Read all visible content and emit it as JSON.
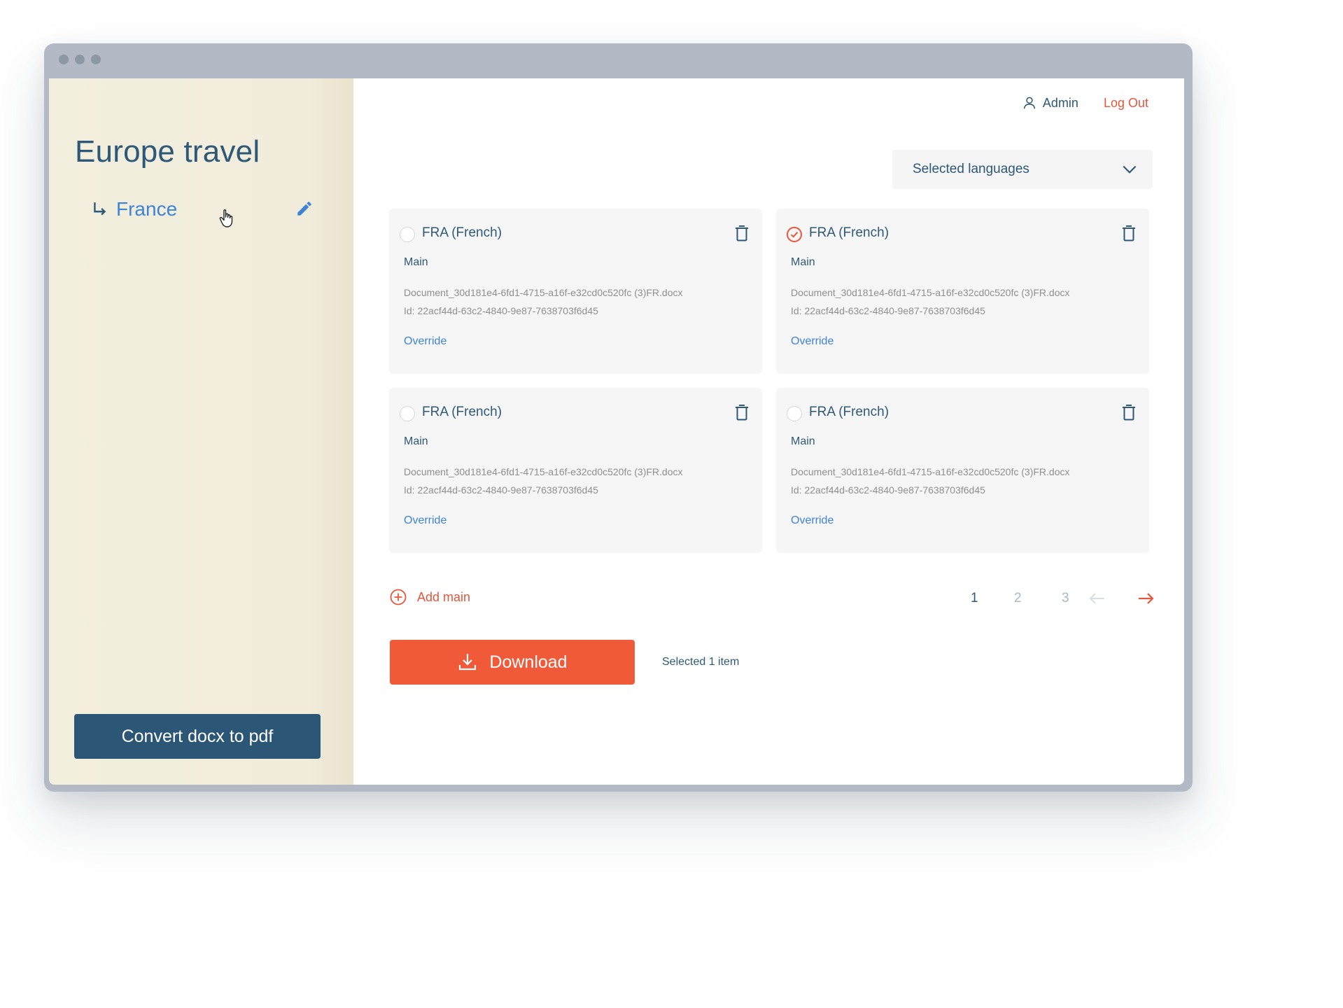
{
  "sidebar": {
    "project_title": "Europe travel",
    "sub_item_label": "France",
    "convert_button_label": "Convert docx to pdf"
  },
  "header": {
    "user_name": "Admin",
    "logout_label": "Log Out"
  },
  "language_select": {
    "selected_label": "Selected languages"
  },
  "cards": [
    {
      "title": "FRA (French)",
      "type": "Main",
      "file": "Document_30d181e4-6fd1-4715-a16f-e32cd0c520fc (3)FR.docx",
      "id": "Id: 22acf44d-63c2-4840-9e87-7638703f6d45",
      "override_label": "Override",
      "selected": false
    },
    {
      "title": "FRA (French)",
      "type": "Main",
      "file": "Document_30d181e4-6fd1-4715-a16f-e32cd0c520fc (3)FR.docx",
      "id": "Id: 22acf44d-63c2-4840-9e87-7638703f6d45",
      "override_label": "Override",
      "selected": true
    },
    {
      "title": "FRA (French)",
      "type": "Main",
      "file": "Document_30d181e4-6fd1-4715-a16f-e32cd0c520fc (3)FR.docx",
      "id": "Id: 22acf44d-63c2-4840-9e87-7638703f6d45",
      "override_label": "Override",
      "selected": false
    },
    {
      "title": "FRA (French)",
      "type": "Main",
      "file": "Document_30d181e4-6fd1-4715-a16f-e32cd0c520fc (3)FR.docx",
      "id": "Id: 22acf44d-63c2-4840-9e87-7638703f6d45",
      "override_label": "Override",
      "selected": false
    }
  ],
  "actions": {
    "add_main_label": "Add main",
    "download_label": "Download",
    "selected_count": "Selected 1 item"
  },
  "pagination": {
    "pages": [
      "1",
      "2",
      "3"
    ],
    "current_page": "1"
  },
  "icons": {
    "sub_item_arrow": "return-arrow-icon",
    "edit": "pencil-icon",
    "user": "user-icon",
    "dropdown": "chevron-down-icon",
    "delete": "trash-icon",
    "selected": "check-circle-icon",
    "add": "plus-circle-icon",
    "download": "download-icon",
    "prev": "arrow-left-icon",
    "next": "arrow-right-icon",
    "cursor": "hand-cursor-icon"
  },
  "colors": {
    "accent": "#f05a38",
    "primary_dark": "#2c5676",
    "link_blue": "#3d83d8",
    "sidebar_bg": "#f3efdf"
  }
}
